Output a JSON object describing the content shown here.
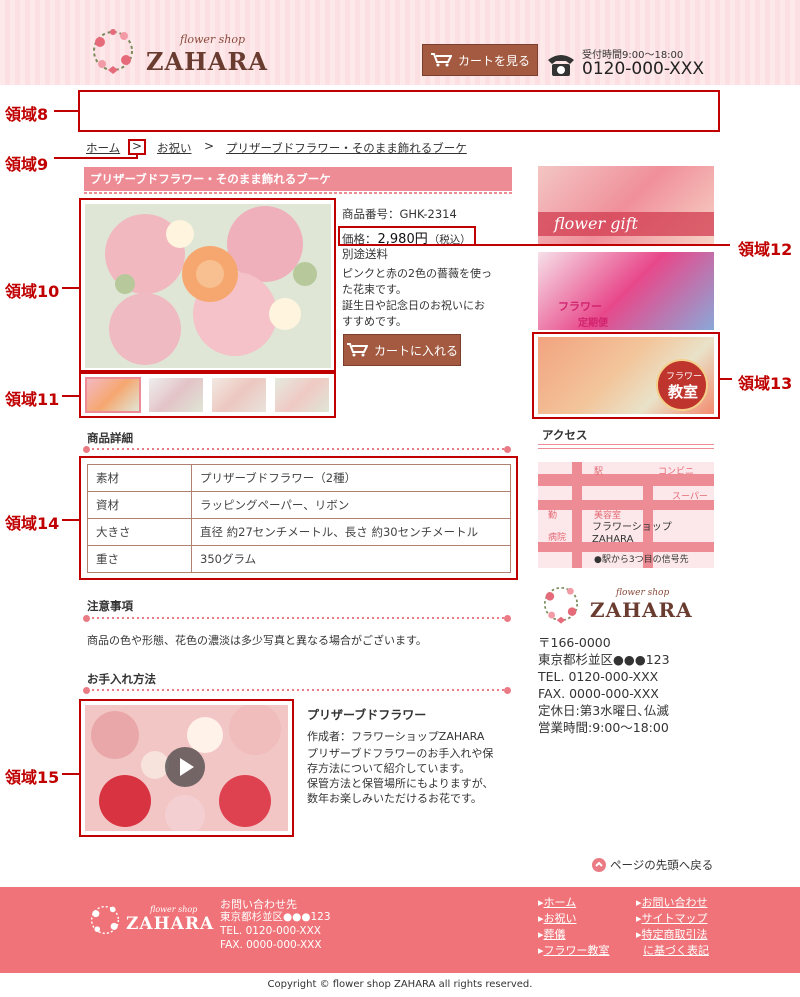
{
  "header": {
    "logo_small": "flower shop",
    "logo_big": "ZAHARA",
    "cart_button": "カートを見る",
    "reception": "受付時間9:00～18:00",
    "phone": "0120-000-XXX"
  },
  "callouts": {
    "r8": "領域8",
    "r9": "領域9",
    "r10": "領域10",
    "r11": "領域11",
    "r12": "領域12",
    "r13": "領域13",
    "r14": "領域14",
    "r15": "領域15"
  },
  "breadcrumb": {
    "home": "ホーム",
    "sep": ">",
    "cat": "お祝い",
    "sep2": ">",
    "current": "プリザーブドフラワー・そのまま飾れるブーケ"
  },
  "product": {
    "title": "プリザーブドフラワー・そのまま飾れるブーケ",
    "code": "商品番号：GHK-2314",
    "price_label": "価格：",
    "price": "2,980円",
    "tax": "（税込）",
    "shipping": "別途送料",
    "description": [
      "ピンクと赤の2色の薔薇を使っ",
      "た花束です。",
      "誕生日や記念日のお祝いにお",
      "すすめです。"
    ],
    "cart_button": "カートに入れる"
  },
  "details": {
    "heading": "商品詳細",
    "rows": [
      {
        "k": "素材",
        "v": "プリザーブドフラワー（2種）"
      },
      {
        "k": "資材",
        "v": "ラッピングペーパー、リボン"
      },
      {
        "k": "大きさ",
        "v": "直径 約27センチメートル、長さ 約30センチメートル"
      },
      {
        "k": "重さ",
        "v": "350グラム"
      }
    ]
  },
  "notes": {
    "heading": "注意事項",
    "text": "商品の色や形態、花色の濃淡は多少写真と異なる場合がございます。"
  },
  "care": {
    "heading": "お手入れ方法",
    "video_title": "プリザーブドフラワー",
    "author": "作成者：フラワーショップZAHARA",
    "text": [
      "プリザーブドフラワーのお手入れや保",
      "存方法について紹介しています。",
      "保管方法と保管場所にもよりますが、",
      "数年お楽しみいただけるお花です。"
    ]
  },
  "sidebar": {
    "banner1": "flower gift",
    "banner2_line1": "フラワー",
    "banner2_line2": "定期便",
    "banner3_line1": "フラワー",
    "banner3_line2": "教室",
    "access_heading": "アクセス",
    "map": {
      "station": "駅",
      "conbini": "コンビニ",
      "super": "スーパー",
      "shrine": "勤",
      "salon": "美容室",
      "hospital": "病院",
      "shop_line1": "フラワーショップ",
      "shop_line2": "ZAHARA",
      "directions": "●駅から3つ目の信号先"
    },
    "logo_small": "flower shop",
    "logo_big": "ZAHARA",
    "address": [
      "〒166-0000",
      "東京都杉並区●●●123",
      "TEL. 0120-000-XXX",
      "FAX. 0000-000-XXX",
      "定休日:第3水曜日､仏滅",
      "営業時間:9:00～18:00"
    ]
  },
  "back_to_top": "ページの先頭へ戻る",
  "footer": {
    "logo_small": "flower shop",
    "logo_big": "ZAHARA",
    "contact_heading": "お問い合わせ先",
    "contact": [
      "東京都杉並区●●●123",
      "TEL. 0120-000-XXX",
      "FAX. 0000-000-XXX"
    ],
    "links1": [
      "ホーム",
      "お祝い",
      "葬儀",
      "フラワー教室"
    ],
    "links2": [
      "お問い合わせ",
      "サイトマップ",
      "特定商取引法",
      "に基づく表記"
    ],
    "copyright": "Copyright © flower shop ZAHARA all rights reserved."
  },
  "colors": {
    "accent": "#ee8c95",
    "brown": "#a35a40",
    "footer": "#ef7378",
    "callout": "#c00000"
  }
}
